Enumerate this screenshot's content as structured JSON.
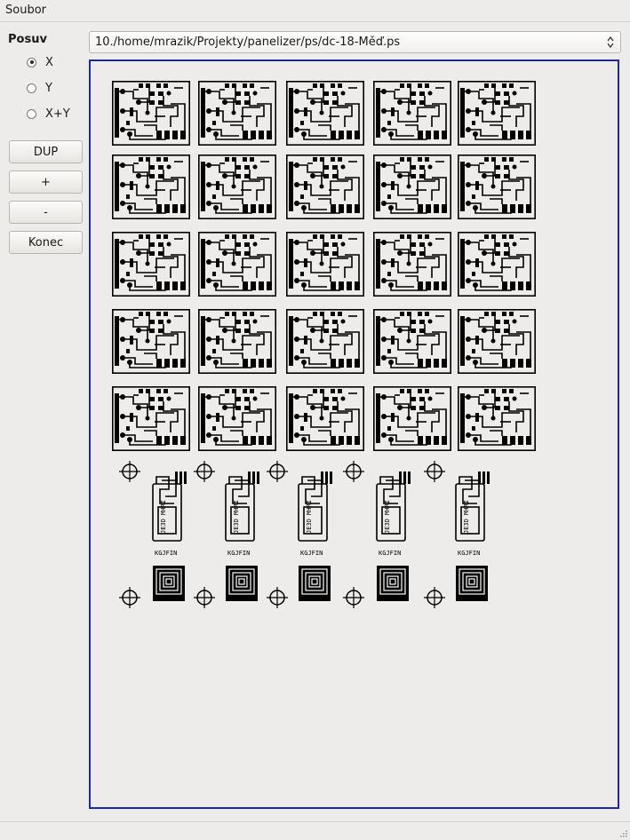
{
  "menubar": {
    "items": [
      {
        "label": "Soubor"
      }
    ]
  },
  "sidebar": {
    "title": "Posuv",
    "radios": [
      {
        "label": "X",
        "checked": true
      },
      {
        "label": "Y",
        "checked": false
      },
      {
        "label": "X+Y",
        "checked": false
      }
    ],
    "buttons": [
      {
        "label": "DUP"
      },
      {
        "label": "+"
      },
      {
        "label": "-"
      },
      {
        "label": "Konec"
      }
    ]
  },
  "file_select": {
    "value": "10./home/mrazik/Projekty/panelizer/ps/dc-18-Měď.ps"
  },
  "canvas": {
    "border_color": "#1b26b8",
    "board_columns": 5,
    "board_rows": 5,
    "small_parts": 5,
    "small_part_label": "KGJFIN",
    "small_part_text": "JE3D MHRI"
  }
}
